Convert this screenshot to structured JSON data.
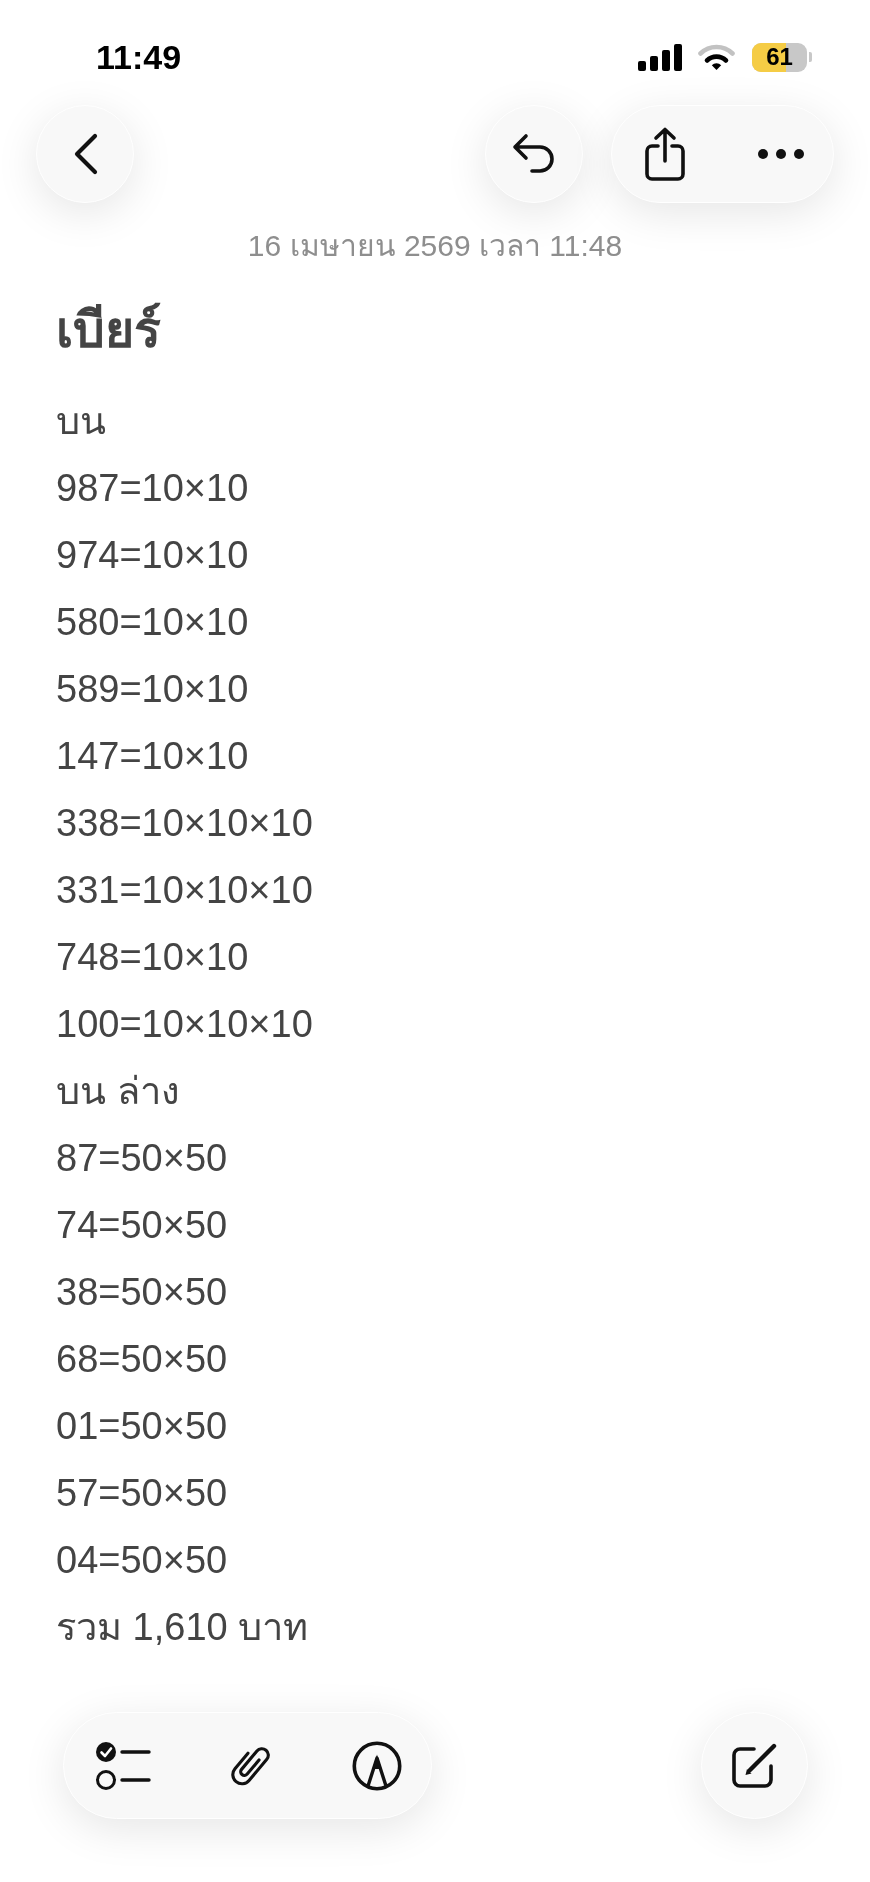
{
  "status_bar": {
    "time": "11:49",
    "battery_percent": "61",
    "low_power": true
  },
  "note": {
    "date": "16 เมษายน 2569 เวลา 11:48",
    "title": "เบียร์",
    "lines": [
      "บน",
      "987=10×10",
      "974=10×10",
      "580=10×10",
      "589=10×10",
      "147=10×10",
      "338=10×10×10",
      "331=10×10×10",
      "748=10×10",
      "100=10×10×10",
      "บน ล่าง",
      "87=50×50",
      "74=50×50",
      "38=50×50",
      "68=50×50",
      "01=50×50",
      "57=50×50",
      "04=50×50",
      "รวม 1,610 บาท"
    ]
  }
}
